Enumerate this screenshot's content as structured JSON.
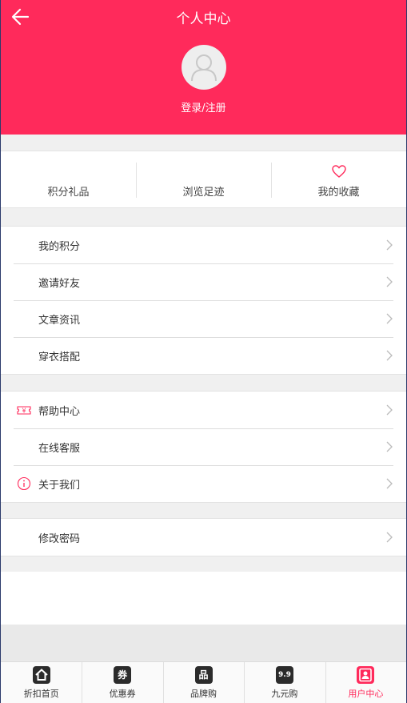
{
  "header": {
    "title": "个人中心",
    "back_icon": "arrow-left-icon",
    "avatar_icon": "user-silhouette-icon",
    "login_label": "登录/注册",
    "bg_color": "#ff2a5b"
  },
  "quick_actions": [
    {
      "label": "积分礼品",
      "icon": null
    },
    {
      "label": "浏览足迹",
      "icon": null
    },
    {
      "label": "我的收藏",
      "icon": "heart-outline-icon"
    }
  ],
  "groups": [
    {
      "items": [
        {
          "label": "我的积分",
          "icon": null
        },
        {
          "label": "邀请好友",
          "icon": null
        },
        {
          "label": "文章资讯",
          "icon": null
        },
        {
          "label": "穿衣搭配",
          "icon": null
        }
      ]
    },
    {
      "items": [
        {
          "label": "帮助中心",
          "icon": "coupon-yuan-icon"
        },
        {
          "label": "在线客服",
          "icon": null
        },
        {
          "label": "关于我们",
          "icon": "info-circle-icon"
        }
      ]
    },
    {
      "items": [
        {
          "label": "修改密码",
          "icon": null
        }
      ]
    }
  ],
  "tabbar": {
    "active_color": "#ff2a5b",
    "tabs": [
      {
        "label": "折扣首页",
        "icon": "home-icon",
        "icon_text": "",
        "active": false
      },
      {
        "label": "优惠券",
        "icon": "coupon-icon",
        "icon_text": "券",
        "active": false
      },
      {
        "label": "品牌购",
        "icon": "brand-icon",
        "icon_text": "品",
        "active": false
      },
      {
        "label": "九元购",
        "icon": "nine-nine-icon",
        "icon_text": "9.9",
        "active": false
      },
      {
        "label": "用户中心",
        "icon": "user-card-icon",
        "icon_text": "",
        "active": true
      }
    ]
  }
}
